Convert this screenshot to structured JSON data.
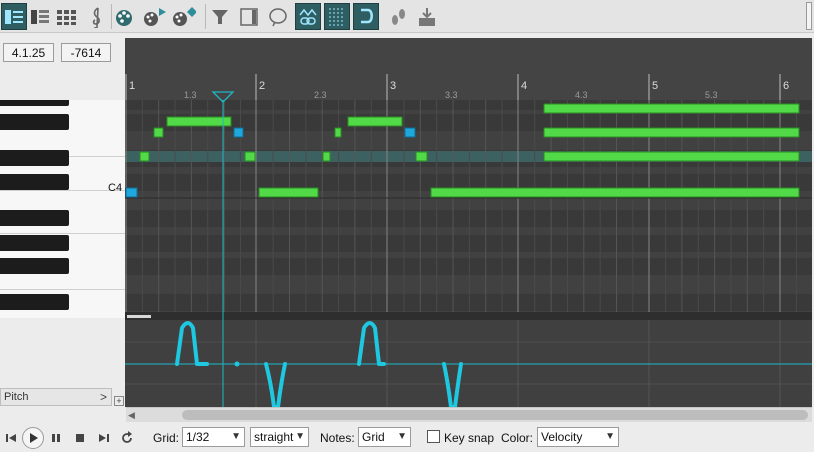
{
  "toolbar": {
    "icons": [
      "piano-roll-icon",
      "named-notes-icon",
      "drum-grid-icon",
      "treble-clef-icon",
      "palette-icon",
      "palette-play-icon",
      "palette-diamond-icon",
      "filter-icon",
      "panel-icon",
      "lasso-icon",
      "link-icon",
      "grid-icon",
      "snap-icon",
      "footprints-icon",
      "insert-icon"
    ]
  },
  "position": {
    "time": "4.1.25",
    "value": "-7614"
  },
  "ruler": {
    "bars": [
      "1",
      "2",
      "3",
      "4",
      "5",
      "6"
    ],
    "sub": [
      "1.3",
      "2.3",
      "3.3",
      "4.3",
      "5.3"
    ]
  },
  "keys": {
    "c4_label": "C4"
  },
  "lane": {
    "name": "Pitch",
    "arrow": ">",
    "add": "+"
  },
  "bottom": {
    "grid_label": "Grid:",
    "grid_value": "1/32",
    "swing_value": "straight",
    "notes_label": "Notes:",
    "notes_value": "Grid",
    "keysnap_label": "Key snap",
    "color_label": "Color:",
    "color_value": "Velocity"
  },
  "colors": {
    "note_green": "#52d947",
    "note_selected": "#1fa8de",
    "pitch_curve": "#1ec8e0",
    "grid_bg": "#414141",
    "toolbar_active": "#2f5e62"
  }
}
